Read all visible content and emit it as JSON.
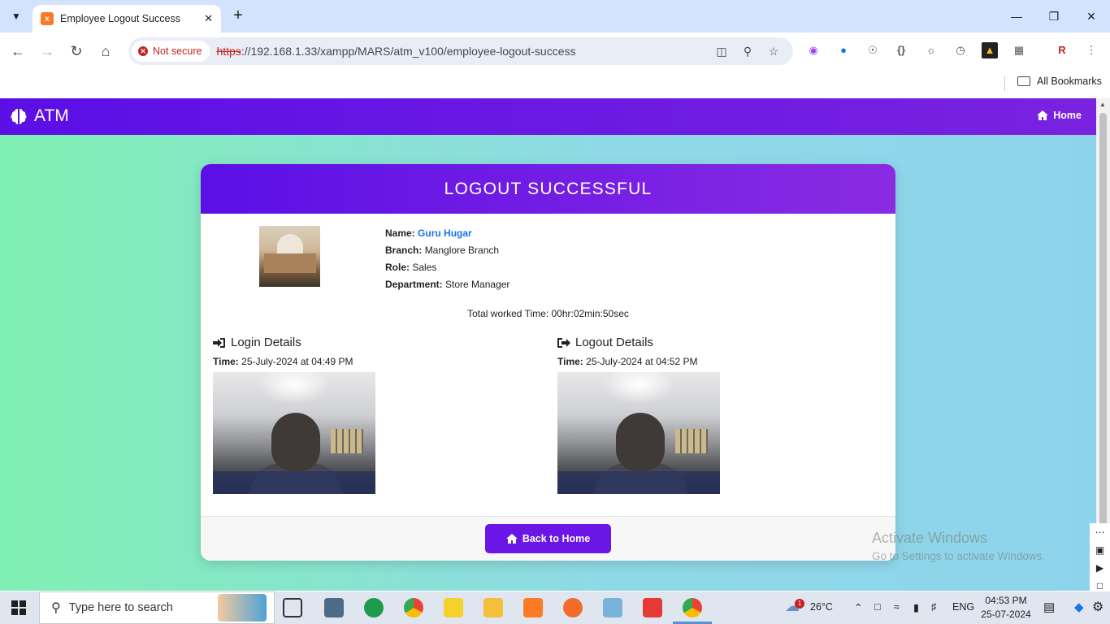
{
  "browser": {
    "tab_title": "Employee Logout Success",
    "tab_favicon_letter": "x",
    "security_label": "Not secure",
    "url_scheme": "https",
    "url_rest": "://192.168.1.33/xampp/MARS/atm_v100/employee-logout-success",
    "bookmarks_label": "All Bookmarks"
  },
  "navbar": {
    "brand": "ATM",
    "home_label": "Home"
  },
  "card": {
    "title": "LOGOUT SUCCESSFUL",
    "employee": {
      "name_label": "Name:",
      "name": "Guru Hugar",
      "branch_label": "Branch:",
      "branch": "Manglore Branch",
      "role_label": "Role:",
      "role": "Sales",
      "department_label": "Department:",
      "department": "Store Manager"
    },
    "total_time": "Total worked Time: 00hr:02min:50sec",
    "login": {
      "title": "Login Details",
      "time_label": "Time:",
      "time": "25-July-2024 at 04:49 PM"
    },
    "logout": {
      "title": "Logout Details",
      "time_label": "Time:",
      "time": "25-July-2024 at 04:52 PM"
    },
    "back_button": "Back to Home"
  },
  "watermark": {
    "title": "Activate Windows",
    "subtitle": "Go to Settings to activate Windows."
  },
  "taskbar": {
    "search_placeholder": "Type here to search",
    "weather_temp": "26°C",
    "weather_badge": "1",
    "language": "ENG",
    "time": "04:53 PM",
    "date": "25-07-2024"
  },
  "colors": {
    "accent": "#6a16e6",
    "navbar_start": "#5b0fe6",
    "navbar_end": "#7a22e0",
    "name_link": "#1a73e8",
    "bg_left": "#7ff0b2",
    "bg_right": "#8ed3ec"
  }
}
